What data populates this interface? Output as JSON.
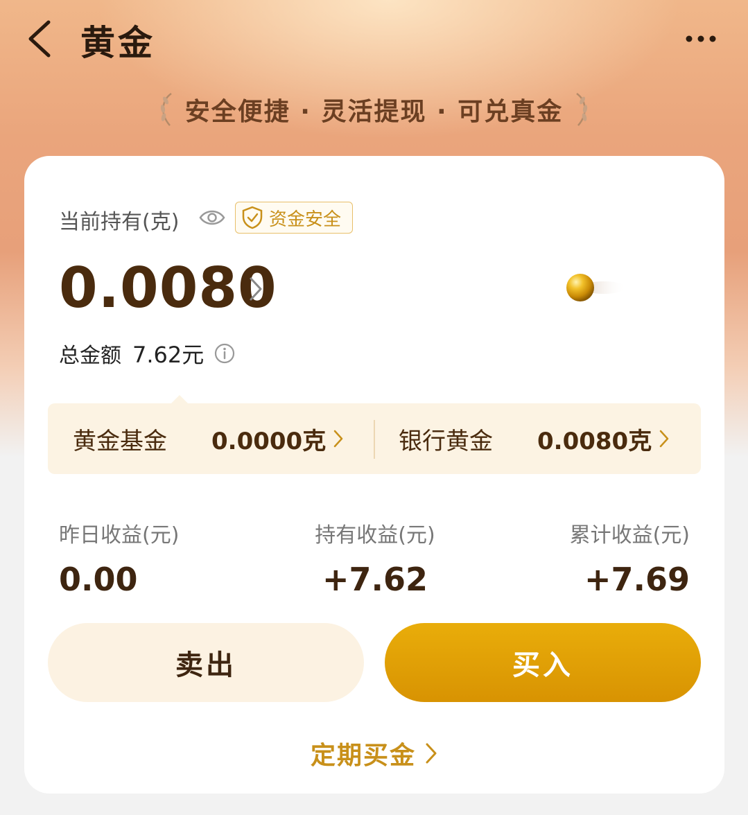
{
  "header": {
    "title": "黄金",
    "back_icon": "chevron-left-icon",
    "more_icon": "more-dots-icon"
  },
  "slogan": {
    "text": "安全便捷 · 灵活提现 · 可兑真金"
  },
  "holding": {
    "label": "当前持有(克)",
    "badge": "资金安全",
    "amount": "0.0080",
    "total_label": "总金额",
    "total_value": "7.62元"
  },
  "split": {
    "fund_label": "黄金基金",
    "fund_value": "0.0000克",
    "bank_label": "银行黄金",
    "bank_value": "0.0080克"
  },
  "stats": {
    "yesterday_label": "昨日收益(元)",
    "yesterday_value": "0.00",
    "holding_label": "持有收益(元)",
    "holding_value": "+7.62",
    "total_label": "累计收益(元)",
    "total_value": "+7.69"
  },
  "actions": {
    "sell_label": "卖出",
    "buy_label": "买入",
    "regular_label": "定期买金"
  },
  "colors": {
    "accent": "#c8901a",
    "buy_button": "#e0a006",
    "text_dark": "#4a2b0e"
  }
}
